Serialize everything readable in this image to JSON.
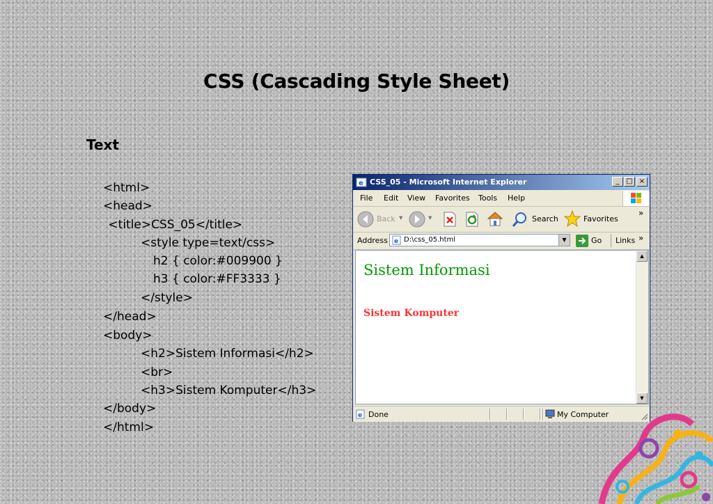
{
  "slide": {
    "title": "CSS (Cascading Style Sheet)",
    "section_label": "Text",
    "code_lines": [
      "<html>",
      "<head>",
      " <title>CSS_05</title>",
      "<style type=text/css>",
      "h2 { color:#009900 }",
      "h3 { color:#FF3333 }",
      "</style>",
      "</head>",
      "<body>",
      "<h2>Sistem Informasi</h2>",
      "<br>",
      "<h3>Sistem Komputer</h3>",
      "</body>",
      "</html>"
    ]
  },
  "browser": {
    "window_title": "CSS_05 - Microsoft Internet Explorer",
    "controls": {
      "minimize": "_",
      "maximize": "□",
      "close": "×"
    },
    "menu": [
      "File",
      "Edit",
      "View",
      "Favorites",
      "Tools",
      "Help"
    ],
    "toolbar": {
      "back_label": "Back",
      "search_label": "Search",
      "favorites_label": "Favorites",
      "overflow": "»"
    },
    "address": {
      "label": "Address",
      "value": "D:\\css_05.html",
      "go_label": "Go",
      "links_label": "Links",
      "overflow": "»"
    },
    "page": {
      "h2_text": "Sistem Informasi",
      "h3_text": "Sistem Komputer",
      "h2_color": "#009900",
      "h3_color": "#FF3333"
    },
    "status": {
      "left_text": "Done",
      "zone_text": "My Computer"
    }
  }
}
